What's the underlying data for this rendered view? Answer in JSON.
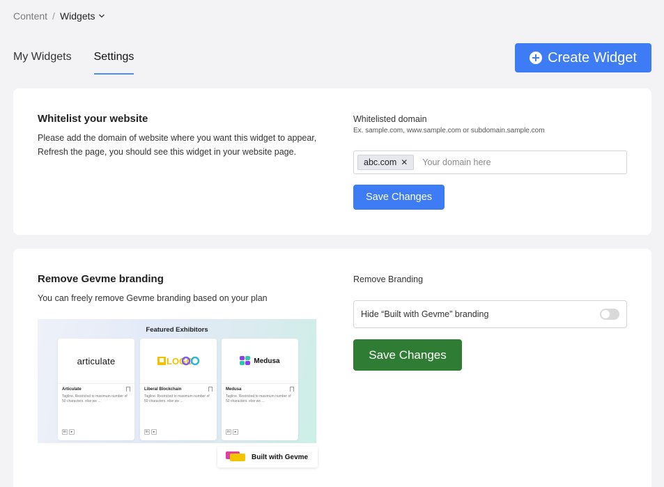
{
  "breadcrumb": {
    "root": "Content",
    "separator": "/",
    "current": "Widgets"
  },
  "tabs": [
    {
      "label": "My Widgets",
      "active": false
    },
    {
      "label": "Settings",
      "active": true
    }
  ],
  "header": {
    "create_label": "Create Widget"
  },
  "whitelist": {
    "title": "Whitelist your website",
    "desc_line1": "Please add the domain of website where you want this widget to appear,",
    "desc_line2": "Refresh the page, you should see this widget in your website page.",
    "field_label": "Whitelisted domain",
    "field_hint": "Ex. sample.com, www.sample.com or subdomain.sample.com",
    "chip": "abc.com",
    "placeholder": "Your domain here",
    "save_label": "Save Changes"
  },
  "branding": {
    "title": "Remove Gevme branding",
    "desc": "You can freely remove Gevme branding based on your plan",
    "field_label": "Remove Branding",
    "toggle_label": "Hide “Built with Gevme” branding",
    "toggle_on": false,
    "save_label": "Save Changes",
    "preview": {
      "title": "Featured Exhibitors",
      "exhibitors": [
        {
          "logo": "articulate",
          "name": "Articulate",
          "desc": "Tagline. Restricted to maximum number of 50 characters. else we ..."
        },
        {
          "logo": "LOGO",
          "name": "Liberal Blockchain",
          "desc": "Tagline. Restricted to maximum number of 50 characters. else we ..."
        },
        {
          "logo": "Medusa",
          "name": "Medusa",
          "desc": "Tagline. Restricted to maximum number of 50 characters. else we ..."
        }
      ],
      "badge_label": "Built with Gevme"
    }
  },
  "colors": {
    "primary": "#3e7cf5",
    "success": "#2f7d34",
    "background": "#f3f3f6"
  }
}
